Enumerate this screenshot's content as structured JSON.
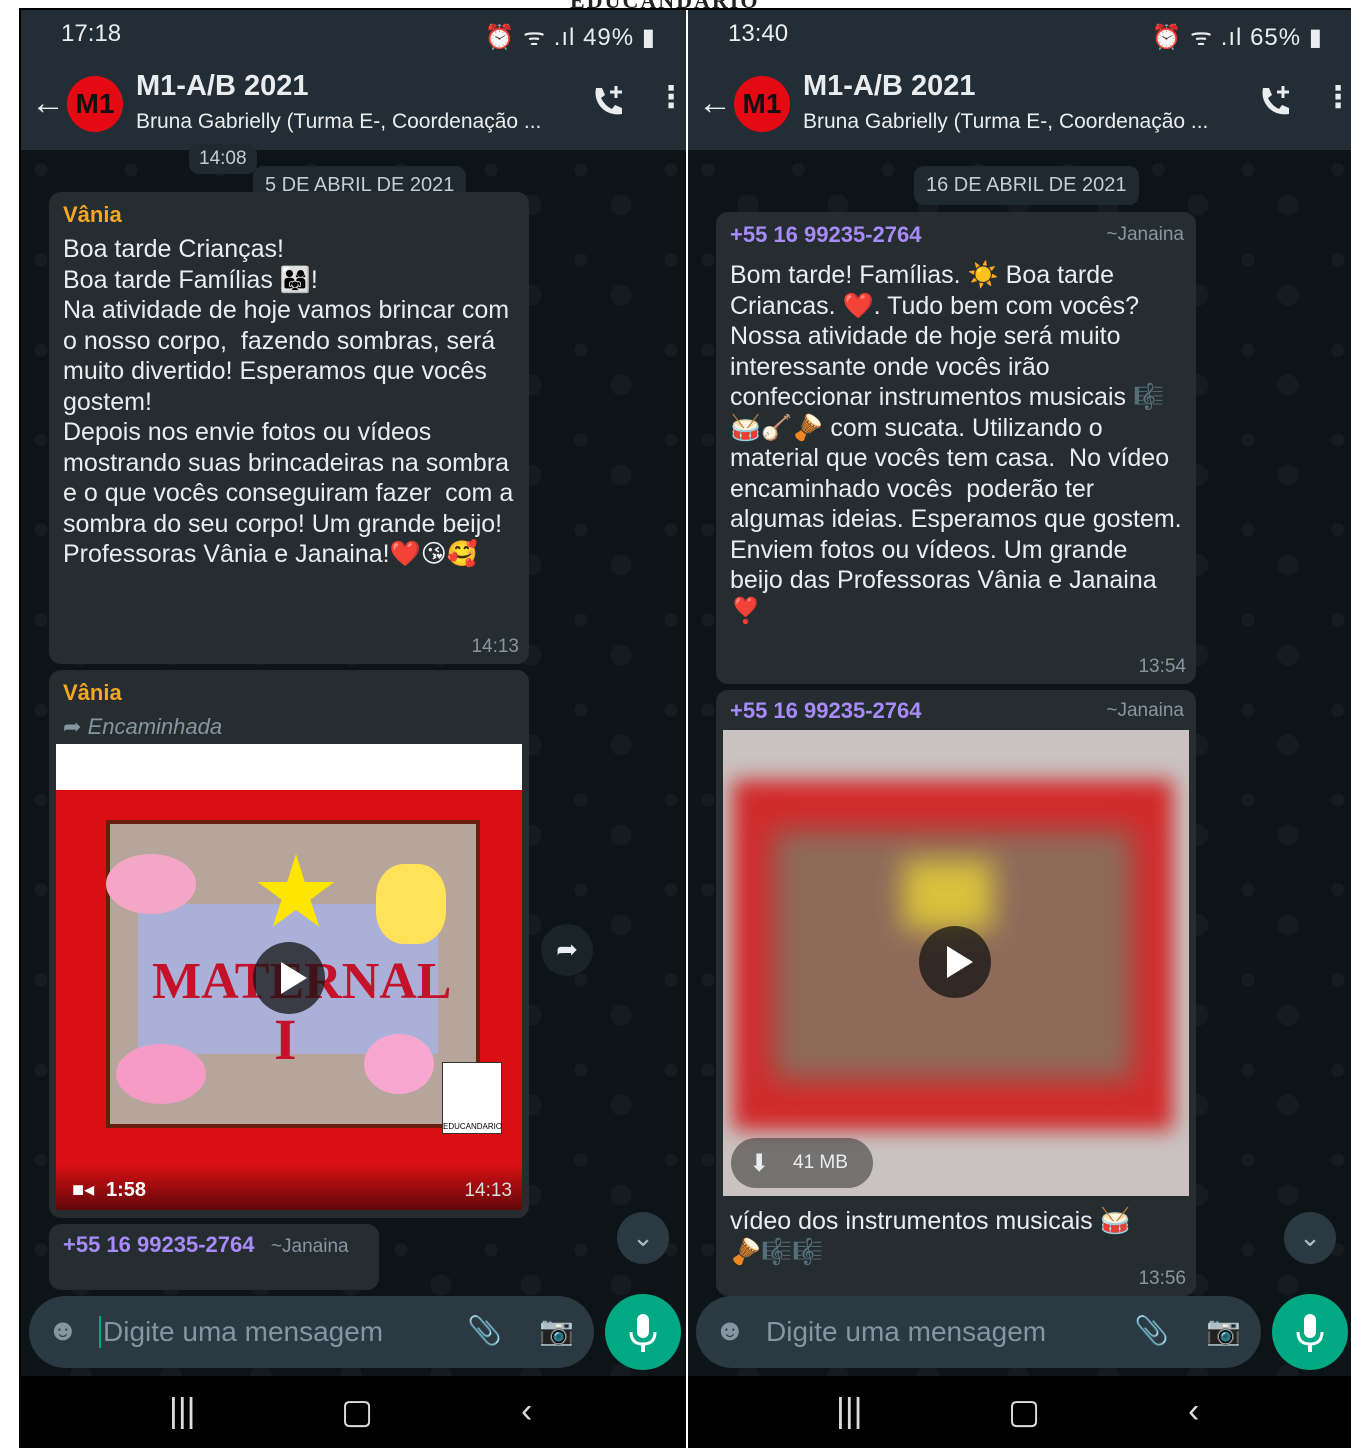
{
  "banner": "EDUCANDARIO",
  "left": {
    "status": {
      "time": "17:18",
      "icons": "⏰ ᯤ .ıl",
      "battery": "49%"
    },
    "header": {
      "title": "M1-A/B 2021",
      "subtitle": "Bruna Gabrielly (Turma E-, Coordenação ...",
      "avatar": "M1"
    },
    "earlier_time": "14:08",
    "date_chip": "5 DE ABRIL DE 2021",
    "msg1": {
      "sender": "Vânia",
      "text": "Boa tarde Crianças!\nBoa tarde Famílias 👨‍👩‍👧!\nNa atividade de hoje vamos brincar com o nosso corpo,  fazendo sombras, será muito divertido! Esperamos que vocês gostem!\nDepois nos envie fotos ou vídeos mostrando suas brincadeiras na sombra e o que vocês conseguiram fazer  com a sombra do seu corpo! Um grande beijo!\nProfessoras Vânia e Janaina!❤️😘🥰",
      "time": "14:13"
    },
    "msg2": {
      "sender": "Vânia",
      "forwarded": "Encaminhada",
      "video_text": "MATERNAL",
      "video_roman": "I",
      "logo": "EDUCANDARIO",
      "duration": "1:58",
      "time": "14:13"
    },
    "msg3": {
      "phone": "+55 16 99235-2764",
      "name": "~Janaina"
    },
    "input_placeholder": "Digite uma mensagem"
  },
  "right": {
    "status": {
      "time": "13:40",
      "icons": "⏰ ᯤ .ıl",
      "battery": "65%"
    },
    "header": {
      "title": "M1-A/B 2021",
      "subtitle": "Bruna Gabrielly (Turma E-, Coordenação ...",
      "avatar": "M1"
    },
    "date_chip": "16 DE ABRIL DE 2021",
    "msg1": {
      "phone": "+55 16 99235-2764",
      "name": "~Janaina",
      "text": "Bom tarde! Famílias. ☀️ Boa tarde Criancas. ❤️. Tudo bem com vocês?\nNossa atividade de hoje será muito interessante onde vocês irão confeccionar instrumentos musicais 🎼🥁🪕🪘 com sucata. Utilizando o material que vocês tem casa.  No vídeo encaminhado vocês  poderão ter algumas ideias. Esperamos que gostem. Enviem fotos ou vídeos. Um grande beijo das Professoras Vânia e Janaina ❣️",
      "time": "13:54"
    },
    "msg2": {
      "phone": "+55 16 99235-2764",
      "name": "~Janaina",
      "size": "41 MB",
      "caption": "vídeo dos instrumentos musicais 🥁\n🪘🎼🎼",
      "time": "13:56"
    },
    "input_placeholder": "Digite uma mensagem"
  },
  "colors": {
    "header": "#232d36",
    "bubble": "#262d31",
    "accent": "#00a884",
    "sender_vania": "#f5a623",
    "sender_phone": "#a78bfa"
  }
}
